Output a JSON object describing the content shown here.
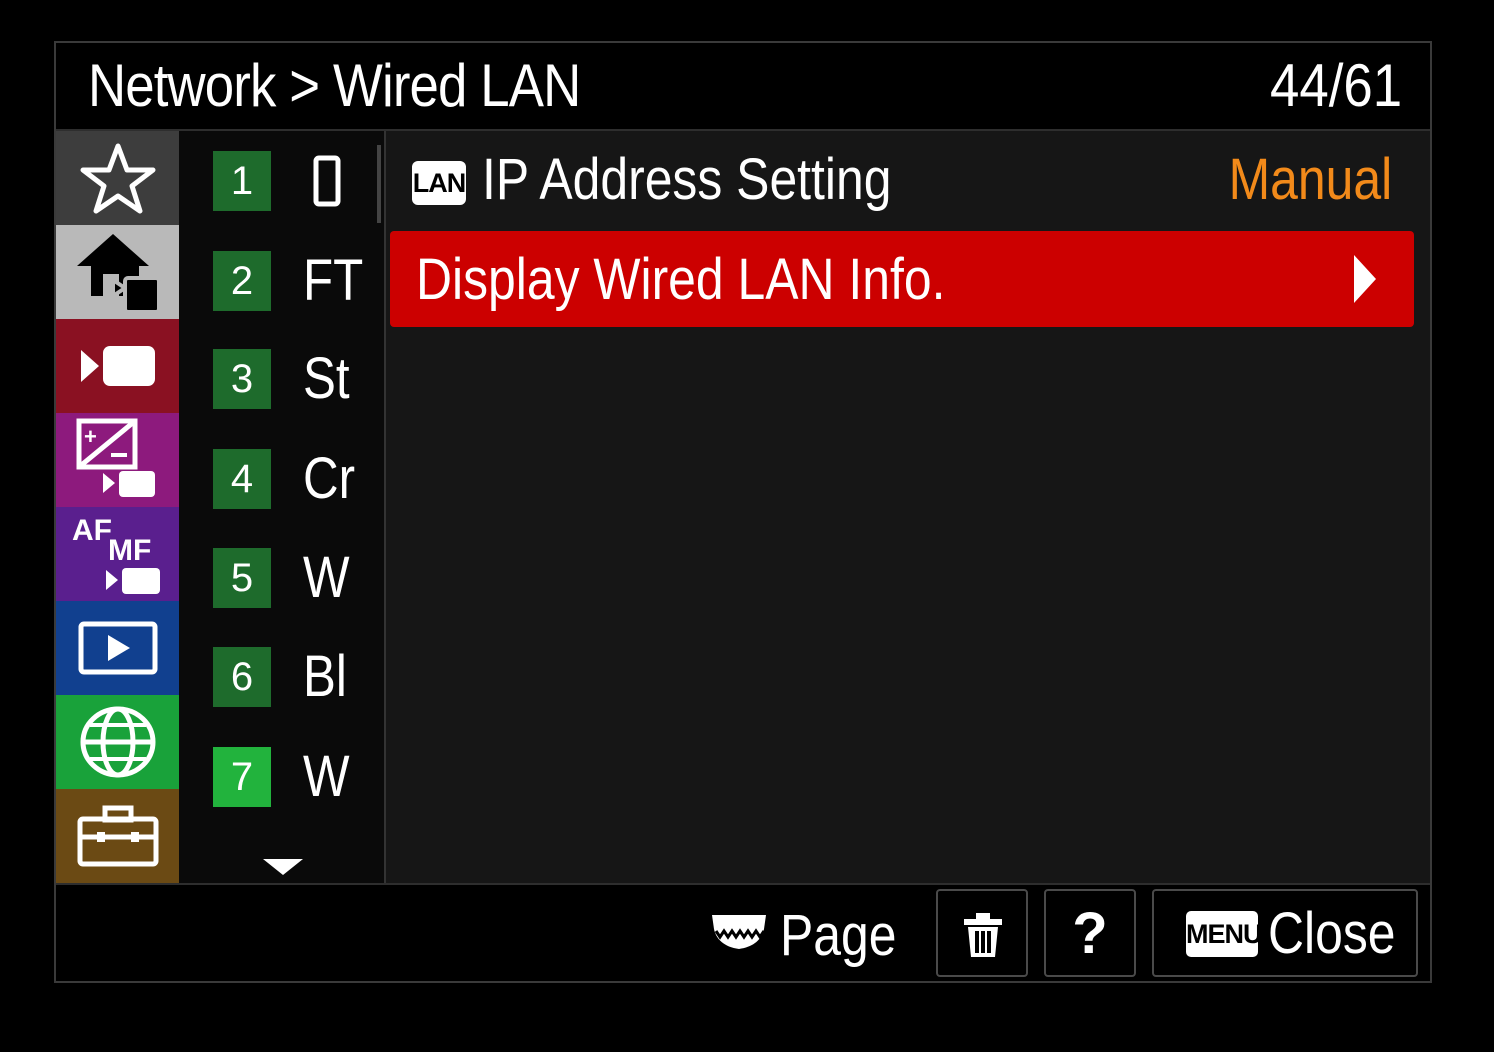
{
  "header": {
    "breadcrumb": "Network > Wired LAN",
    "page_counter": "44/61"
  },
  "categories": [
    {
      "icon": "star-icon",
      "color": "#3d3d3d"
    },
    {
      "icon": "home-movie-icon",
      "color": "#b9b9b9"
    },
    {
      "icon": "movie-camera-icon",
      "color": "#8a1122"
    },
    {
      "icon": "exposure-movie-icon",
      "color": "#8d1a7d"
    },
    {
      "icon": "af-mf-movie-icon",
      "color": "#5a1f8e"
    },
    {
      "icon": "playback-icon",
      "color": "#11408f"
    },
    {
      "icon": "globe-network-icon",
      "color": "#19a23a"
    },
    {
      "icon": "toolbox-icon",
      "color": "#6b4a14"
    }
  ],
  "af_mf_labels": {
    "af": "AF",
    "mf": "MF"
  },
  "pages": [
    {
      "num": "1",
      "abbr": "",
      "icon": "smartphone-icon"
    },
    {
      "num": "2",
      "abbr": "FT"
    },
    {
      "num": "3",
      "abbr": "St"
    },
    {
      "num": "4",
      "abbr": "Cr"
    },
    {
      "num": "5",
      "abbr": "W"
    },
    {
      "num": "6",
      "abbr": "Bl"
    },
    {
      "num": "7",
      "abbr": "W"
    }
  ],
  "items": {
    "ip_address": {
      "badge": "LAN",
      "label": "IP Address Setting",
      "value": "Manual"
    },
    "display_info": {
      "label": "Display Wired LAN Info."
    }
  },
  "footer": {
    "page_label": "Page",
    "help_label": "?",
    "menu_badge": "MENU",
    "close_label": "Close"
  },
  "colors": {
    "selected_row": "#cc0000",
    "value_text": "#f28a1a",
    "page_active": "#22b33d",
    "page_inactive": "#1e6b2c"
  }
}
